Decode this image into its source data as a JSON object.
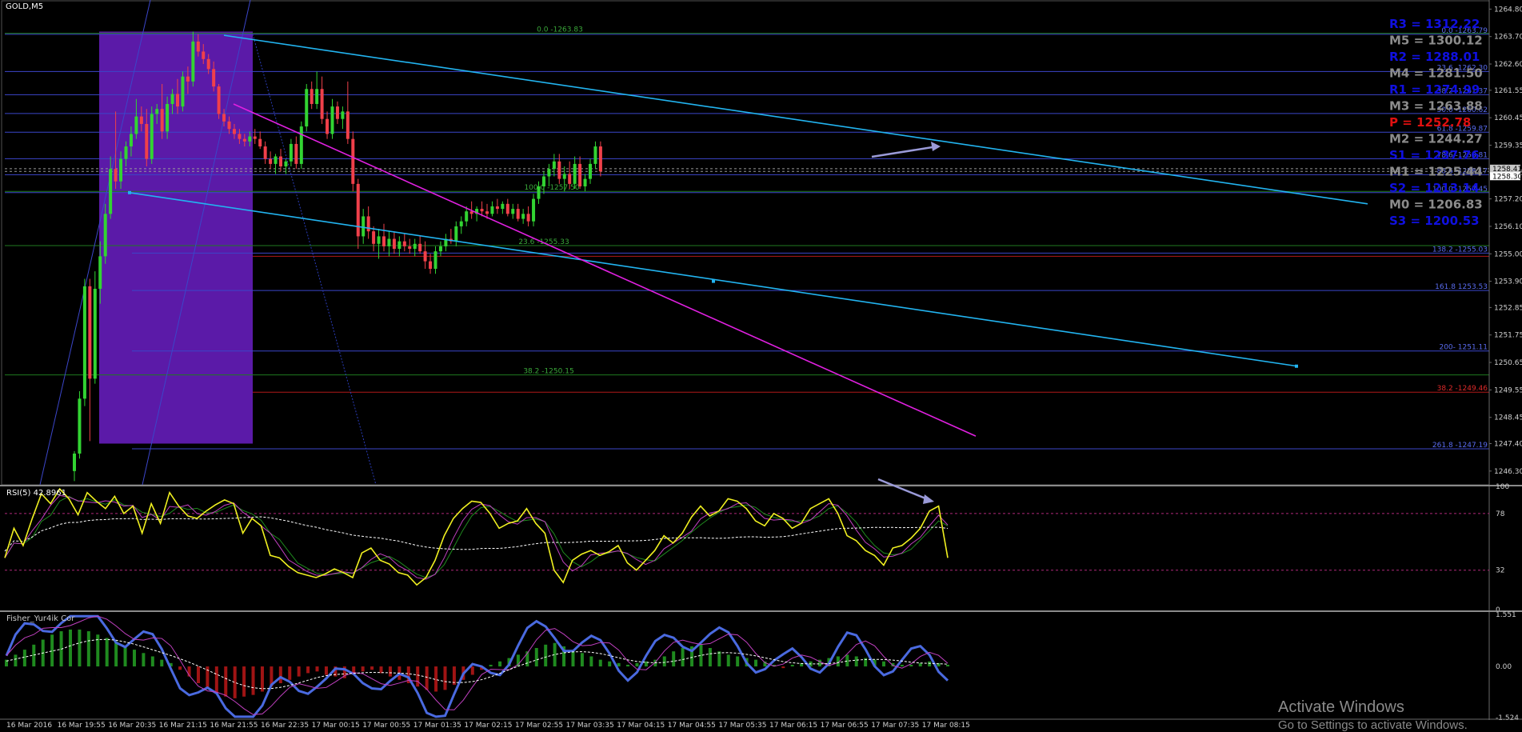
{
  "chart_data": [
    {
      "type": "candlestick",
      "title": "GOLD,M5",
      "ylim": [
        1245.75,
        1265.1
      ],
      "y_ticks": [
        "1264.80",
        "1263.70",
        "1262.60",
        "1261.55",
        "1260.45",
        "1259.35",
        "1258.25",
        "1257.20",
        "1256.10",
        "1255.00",
        "1253.90",
        "1252.85",
        "1251.75",
        "1250.65",
        "1249.55",
        "1248.45",
        "1247.40",
        "1246.30"
      ],
      "price_labels": [
        "1258.41",
        "1258.30"
      ],
      "x_ticks": [
        "16 Mar 2016",
        "16 Mar 19:55",
        "16 Mar 20:35",
        "16 Mar 21:15",
        "16 Mar 21:55",
        "16 Mar 22:35",
        "17 Mar 00:15",
        "17 Mar 00:55",
        "17 Mar 01:35",
        "17 Mar 02:15",
        "17 Mar 02:55",
        "17 Mar 03:35",
        "17 Mar 04:15",
        "17 Mar 04:55",
        "17 Mar 05:35",
        "17 Mar 06:15",
        "17 Mar 06:55",
        "17 Mar 07:35",
        "17 Mar 08:15"
      ],
      "pivots": [
        {
          "label": "R3 = 1312.22",
          "color": "#1010e0"
        },
        {
          "label": "M5 = 1300.12",
          "color": "#8c8c8c"
        },
        {
          "label": "R2 = 1288.01",
          "color": "#1010e0"
        },
        {
          "label": "M4 = 1281.50",
          "color": "#8c8c8c"
        },
        {
          "label": "R1 = 1274.99",
          "color": "#1010e0"
        },
        {
          "label": "M3 = 1263.88",
          "color": "#8c8c8c"
        },
        {
          "label": "P   = 1252.78",
          "color": "#e01010"
        },
        {
          "label": "M2 = 1244.27",
          "color": "#8c8c8c"
        },
        {
          "label": "S1 = 1237.76",
          "color": "#1010e0"
        },
        {
          "label": "M1 = 1225.44",
          "color": "#8c8c8c"
        },
        {
          "label": "S2 = 1213.14",
          "color": "#1010e0"
        },
        {
          "label": "M0 = 1206.83",
          "color": "#8c8c8c"
        },
        {
          "label": "S3 = 1200.53",
          "color": "#1010e0"
        }
      ],
      "fib_right": [
        {
          "label": "0.0 -1263.79",
          "price": 1263.79
        },
        {
          "label": "23.6 -1262.30",
          "price": 1262.3
        },
        {
          "label": "38.2 -1261.37",
          "price": 1261.37
        },
        {
          "label": "50.0 -1260.62",
          "price": 1260.62
        },
        {
          "label": "61.8 -1259.87",
          "price": 1259.87
        },
        {
          "label": "78.6 -1258.81",
          "price": 1258.81
        },
        {
          "label": "88.6 -1258.17",
          "price": 1258.17
        },
        {
          "label": "100.0 -1257.45",
          "price": 1257.45
        },
        {
          "label": "138.2 -1255.03",
          "price": 1255.03
        },
        {
          "label": "161.8 1253.53",
          "price": 1253.53
        },
        {
          "label": "200- 1251.11",
          "price": 1251.11
        },
        {
          "label": "261.8 -1247.19",
          "price": 1247.19
        }
      ],
      "fib_left": [
        {
          "label": "0.0 -1263.83",
          "price": 1263.83
        },
        {
          "label": "100.0 -1257.50",
          "price": 1257.5
        },
        {
          "label": "23.6 -1255.33",
          "price": 1255.33
        },
        {
          "label": "38.2 -1250.15",
          "price": 1250.15
        }
      ],
      "red_level": {
        "label": "38.2 -1249.46",
        "price": 1249.46
      },
      "candles": [
        [
          1246.3,
          1247.1,
          1245.9,
          1247.0
        ],
        [
          1247.0,
          1249.5,
          1246.8,
          1249.2
        ],
        [
          1249.2,
          1254.0,
          1248.9,
          1253.7
        ],
        [
          1253.7,
          1254.0,
          1247.5,
          1250.0
        ],
        [
          1250.0,
          1254.3,
          1249.8,
          1253.6
        ],
        [
          1253.6,
          1255.5,
          1253.0,
          1254.9
        ],
        [
          1254.9,
          1257.0,
          1254.6,
          1256.6
        ],
        [
          1256.6,
          1258.9,
          1256.4,
          1258.4
        ],
        [
          1258.4,
          1260.7,
          1257.6,
          1257.9
        ],
        [
          1257.9,
          1259.1,
          1257.6,
          1258.8
        ],
        [
          1258.8,
          1259.5,
          1258.5,
          1259.3
        ],
        [
          1259.3,
          1260.1,
          1258.9,
          1259.8
        ],
        [
          1259.8,
          1261.2,
          1259.6,
          1260.5
        ],
        [
          1260.5,
          1260.9,
          1259.9,
          1260.2
        ],
        [
          1260.2,
          1260.8,
          1258.5,
          1258.8
        ],
        [
          1258.8,
          1260.9,
          1258.6,
          1260.6
        ],
        [
          1260.6,
          1261.0,
          1260.2,
          1260.8
        ],
        [
          1260.8,
          1261.8,
          1259.6,
          1259.9
        ],
        [
          1259.9,
          1261.3,
          1259.6,
          1261.0
        ],
        [
          1261.0,
          1261.6,
          1260.6,
          1261.4
        ],
        [
          1261.4,
          1262.0,
          1260.6,
          1260.9
        ],
        [
          1260.9,
          1262.3,
          1260.7,
          1262.1
        ],
        [
          1262.1,
          1262.5,
          1261.4,
          1261.9
        ],
        [
          1261.9,
          1263.9,
          1261.7,
          1263.5
        ],
        [
          1263.5,
          1263.8,
          1262.9,
          1263.1
        ],
        [
          1263.1,
          1263.4,
          1262.6,
          1262.8
        ],
        [
          1262.8,
          1263.0,
          1262.2,
          1262.4
        ],
        [
          1262.4,
          1262.7,
          1261.5,
          1261.7
        ],
        [
          1261.7,
          1261.8,
          1260.4,
          1260.6
        ],
        [
          1260.6,
          1260.8,
          1260.1,
          1260.3
        ],
        [
          1260.3,
          1260.5,
          1259.8,
          1260.0
        ],
        [
          1260.0,
          1260.2,
          1259.6,
          1259.8
        ],
        [
          1259.8,
          1260.0,
          1259.4,
          1259.6
        ],
        [
          1259.6,
          1259.8,
          1259.3,
          1259.5
        ],
        [
          1259.5,
          1259.9,
          1259.3,
          1259.7
        ],
        [
          1259.7,
          1260.0,
          1259.4,
          1259.6
        ],
        [
          1259.6,
          1259.9,
          1259.2,
          1259.3
        ],
        [
          1259.3,
          1259.5,
          1258.6,
          1258.8
        ],
        [
          1258.8,
          1259.1,
          1258.4,
          1258.6
        ],
        [
          1258.6,
          1259.0,
          1258.2,
          1258.9
        ],
        [
          1258.9,
          1259.2,
          1258.3,
          1258.5
        ],
        [
          1258.5,
          1258.8,
          1258.2,
          1258.7
        ],
        [
          1258.7,
          1259.6,
          1258.5,
          1259.4
        ],
        [
          1259.4,
          1259.7,
          1258.4,
          1258.6
        ],
        [
          1258.6,
          1260.3,
          1258.4,
          1260.1
        ],
        [
          1260.1,
          1261.8,
          1259.9,
          1261.6
        ],
        [
          1261.6,
          1261.9,
          1260.8,
          1261.0
        ],
        [
          1261.0,
          1262.3,
          1260.8,
          1261.6
        ],
        [
          1261.6,
          1262.1,
          1260.2,
          1260.4
        ],
        [
          1260.4,
          1260.7,
          1259.6,
          1259.8
        ],
        [
          1259.8,
          1261.2,
          1259.6,
          1260.9
        ],
        [
          1260.9,
          1261.1,
          1260.2,
          1260.4
        ],
        [
          1260.4,
          1260.9,
          1260.0,
          1260.7
        ],
        [
          1260.7,
          1261.9,
          1259.4,
          1259.6
        ],
        [
          1259.6,
          1259.9,
          1257.5,
          1257.8
        ],
        [
          1257.8,
          1258.0,
          1255.2,
          1255.7
        ],
        [
          1255.7,
          1256.8,
          1255.4,
          1256.5
        ],
        [
          1256.5,
          1256.9,
          1255.6,
          1255.9
        ],
        [
          1255.9,
          1256.1,
          1255.1,
          1255.4
        ],
        [
          1255.4,
          1256.0,
          1254.8,
          1255.7
        ],
        [
          1255.7,
          1256.2,
          1255.1,
          1255.3
        ],
        [
          1255.3,
          1255.9,
          1254.9,
          1255.6
        ],
        [
          1255.6,
          1255.9,
          1255.0,
          1255.2
        ],
        [
          1255.2,
          1255.7,
          1254.9,
          1255.5
        ],
        [
          1255.5,
          1255.8,
          1255.1,
          1255.3
        ],
        [
          1255.3,
          1255.6,
          1255.0,
          1255.2
        ],
        [
          1255.2,
          1255.6,
          1254.9,
          1255.4
        ],
        [
          1255.4,
          1255.7,
          1255.0,
          1255.1
        ],
        [
          1255.1,
          1255.5,
          1254.4,
          1254.7
        ],
        [
          1254.7,
          1255.0,
          1254.2,
          1254.4
        ],
        [
          1254.4,
          1255.3,
          1254.2,
          1255.1
        ],
        [
          1255.1,
          1255.5,
          1254.9,
          1255.3
        ],
        [
          1255.3,
          1255.8,
          1255.1,
          1255.6
        ],
        [
          1255.6,
          1256.0,
          1255.4,
          1255.5
        ],
        [
          1255.5,
          1256.3,
          1255.3,
          1256.1
        ],
        [
          1256.1,
          1256.5,
          1255.8,
          1256.3
        ],
        [
          1256.3,
          1256.9,
          1256.1,
          1256.7
        ],
        [
          1256.7,
          1257.1,
          1256.4,
          1256.6
        ],
        [
          1256.6,
          1256.9,
          1256.3,
          1256.8
        ],
        [
          1256.8,
          1257.1,
          1256.5,
          1256.7
        ],
        [
          1256.7,
          1257.0,
          1256.4,
          1256.6
        ],
        [
          1256.6,
          1257.1,
          1256.5,
          1256.9
        ],
        [
          1256.9,
          1257.2,
          1256.6,
          1256.8
        ],
        [
          1256.8,
          1257.1,
          1256.6,
          1257.0
        ],
        [
          1257.0,
          1257.2,
          1256.5,
          1256.6
        ],
        [
          1256.6,
          1257.0,
          1256.4,
          1256.8
        ],
        [
          1256.8,
          1257.0,
          1256.3,
          1256.4
        ],
        [
          1256.4,
          1256.8,
          1256.2,
          1256.6
        ],
        [
          1256.6,
          1256.9,
          1256.1,
          1256.3
        ],
        [
          1256.3,
          1257.4,
          1256.1,
          1257.2
        ],
        [
          1257.2,
          1257.9,
          1257.0,
          1257.7
        ],
        [
          1257.7,
          1258.3,
          1257.4,
          1258.1
        ],
        [
          1258.1,
          1258.6,
          1257.7,
          1258.4
        ],
        [
          1258.4,
          1259.0,
          1258.1,
          1258.7
        ],
        [
          1258.7,
          1259.0,
          1257.8,
          1258.0
        ],
        [
          1258.0,
          1258.5,
          1257.5,
          1258.2
        ],
        [
          1258.2,
          1258.7,
          1257.6,
          1257.8
        ],
        [
          1257.8,
          1258.9,
          1257.6,
          1258.6
        ],
        [
          1258.6,
          1258.9,
          1257.6,
          1257.7
        ],
        [
          1257.7,
          1258.2,
          1257.5,
          1258.0
        ],
        [
          1258.0,
          1258.8,
          1257.8,
          1258.6
        ],
        [
          1258.6,
          1259.5,
          1258.4,
          1259.3
        ],
        [
          1259.3,
          1259.5,
          1258.1,
          1258.3
        ]
      ]
    },
    {
      "type": "line",
      "title": "RSI(5) 42.8961",
      "ylim": [
        0,
        100
      ],
      "y_ticks": [
        "100",
        "78",
        "32",
        "0"
      ],
      "levels": [
        78,
        32
      ],
      "series": [
        {
          "values": [
            42,
            66,
            52,
            74,
            94,
            86,
            98,
            90,
            77,
            95,
            88,
            82,
            92,
            78,
            84,
            62,
            86,
            70,
            95,
            84,
            76,
            74,
            80,
            85,
            89,
            86,
            62,
            74,
            68,
            44,
            42,
            35,
            30,
            28,
            26,
            29,
            33,
            30,
            26,
            46,
            50,
            40,
            37,
            30,
            28,
            20,
            26,
            40,
            60,
            74,
            82,
            88,
            87,
            78,
            66,
            70,
            72,
            82,
            70,
            62,
            32,
            22,
            40,
            45,
            48,
            44,
            47,
            52,
            38,
            32,
            40,
            48,
            60,
            54,
            62,
            75,
            84,
            76,
            80,
            90,
            88,
            82,
            72,
            68,
            78,
            74,
            66,
            70,
            82,
            86,
            90,
            78,
            60,
            56,
            48,
            44,
            36,
            50,
            52,
            58,
            66,
            80,
            84,
            42
          ]
        }
      ]
    },
    {
      "type": "bar",
      "title": "Fisher_Yur4ik Cor",
      "ylim": [
        -1.55,
        1.6
      ],
      "y_ticks": [
        "1.551",
        "0.00",
        "-1.524"
      ],
      "values": [
        0.2,
        0.35,
        0.5,
        0.65,
        0.8,
        0.95,
        1.05,
        1.1,
        1.1,
        1.05,
        0.95,
        0.85,
        0.75,
        0.6,
        0.5,
        0.4,
        0.3,
        0.2,
        0.1,
        -0.1,
        -0.3,
        -0.5,
        -0.65,
        -0.8,
        -0.9,
        -0.95,
        -0.9,
        -0.85,
        -0.75,
        -0.6,
        -0.5,
        -0.4,
        -0.3,
        -0.2,
        -0.15,
        -0.25,
        -0.3,
        -0.35,
        -0.25,
        -0.15,
        -0.1,
        -0.2,
        -0.3,
        -0.4,
        -0.5,
        -0.6,
        -0.7,
        -0.75,
        -0.7,
        -0.55,
        -0.4,
        -0.25,
        -0.1,
        0.05,
        0.15,
        0.25,
        0.35,
        0.45,
        0.55,
        0.65,
        0.7,
        0.6,
        0.5,
        0.4,
        0.3,
        0.2,
        0.15,
        0.1,
        0.05,
        0.1,
        0.15,
        0.2,
        0.3,
        0.45,
        0.55,
        0.6,
        0.65,
        0.55,
        0.45,
        0.35,
        0.3,
        0.25,
        0.2,
        0.15,
        0.05,
        -0.05,
        0.05,
        0.1,
        0.15,
        0.2,
        0.25,
        0.3,
        0.35,
        0.3,
        0.25,
        0.2,
        0.15,
        0.1,
        0.05,
        0.05,
        0.1,
        0.15,
        0.1,
        0.05
      ]
    }
  ],
  "watermark": {
    "title": "Activate Windows",
    "subtitle": "Go to Settings to activate Windows."
  }
}
